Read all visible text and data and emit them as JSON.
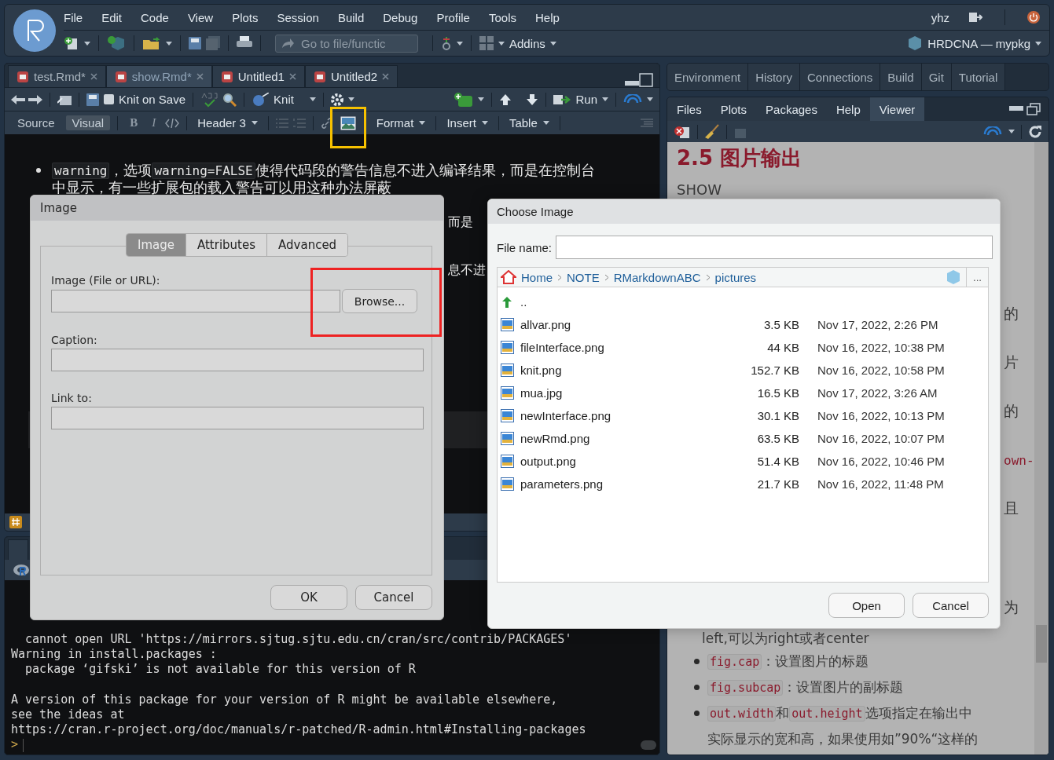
{
  "menu": [
    "File",
    "Edit",
    "Code",
    "View",
    "Plots",
    "Session",
    "Build",
    "Debug",
    "Profile",
    "Tools",
    "Help"
  ],
  "user": "yhz",
  "main_toolbar": {
    "goto_placeholder": "Go to file/functic",
    "addins": "Addins",
    "project": "HRDCNA — mypkg"
  },
  "source": {
    "tabs": [
      {
        "label": "test.Rmd*",
        "selected": false
      },
      {
        "label": "show.Rmd*",
        "selected": true
      },
      {
        "label": "Untitled1",
        "selected": false
      },
      {
        "label": "Untitled2",
        "selected": false
      }
    ],
    "knit_on_save": {
      "label": "Knit on Save",
      "checked": false
    },
    "knit": "Knit",
    "run": "Run",
    "modes": [
      {
        "label": "Source",
        "selected": false
      },
      {
        "label": "Visual",
        "selected": true
      }
    ],
    "format_items": [
      {
        "kind": "bold",
        "label": "B"
      },
      {
        "kind": "italic",
        "label": "I"
      },
      {
        "kind": "code"
      },
      {
        "kind": "menu",
        "label": "Header 3"
      },
      {
        "kind": "bullets"
      },
      {
        "kind": "numbers"
      },
      {
        "kind": "link"
      },
      {
        "kind": "image",
        "highlighted": true
      },
      {
        "kind": "menu",
        "label": "Format"
      },
      {
        "kind": "menu",
        "label": "Insert"
      },
      {
        "kind": "menu",
        "label": "Table"
      }
    ],
    "bullet": [
      {
        "kind": "code",
        "text": "warning"
      },
      {
        "kind": "text",
        "text": "，选项"
      },
      {
        "kind": "code",
        "text": "warning=FALSE"
      },
      {
        "kind": "text",
        "text": "使得代码段的警告信息不进入编译结果，而是在控制台"
      }
    ],
    "continuation": "中显示，有一些扩展包的载入警告可以用这种办法屏蔽",
    "fragments": [
      "而是",
      "息不进"
    ]
  },
  "console": {
    "lines": [
      "  cannot open URL 'https://mirrors.sjtug.sjtu.edu.cn/cran/src/contrib/PACKAGES'",
      "Warning in install.packages :",
      "  package ‘gifski’ is not available for this version of R",
      "A version of this package for your version of R might be available elsewhere,",
      "see the ideas at",
      "https://cran.r-project.org/doc/manuals/r-patched/R-admin.html#Installing-packages"
    ],
    "prompt": ">"
  },
  "env_tabs": [
    "Environment",
    "History",
    "Connections",
    "Build",
    "Git",
    "Tutorial"
  ],
  "files_tabs": [
    {
      "label": "Files",
      "selected": false
    },
    {
      "label": "Plots",
      "selected": false
    },
    {
      "label": "Packages",
      "selected": false
    },
    {
      "label": "Help",
      "selected": false
    },
    {
      "label": "Viewer",
      "selected": true
    }
  ],
  "viewer": {
    "heading": "2.5 图片输出",
    "subheading": "SHOW",
    "fragments": [
      {
        "kind": "text",
        "text": "的"
      },
      {
        "kind": "text",
        "text": "片"
      },
      {
        "kind": "text",
        "text": "的"
      },
      {
        "kind": "code",
        "text": "own-"
      },
      {
        "kind": "text",
        "text": "且"
      },
      {
        "kind": "text",
        "text": "为"
      }
    ],
    "line": "left,可以为right或者center",
    "bullets": [
      [
        {
          "kind": "code",
          "text": "fig.cap"
        },
        {
          "kind": "text",
          "text": "：设置图片的标题"
        }
      ],
      [
        {
          "kind": "code",
          "text": "fig.subcap"
        },
        {
          "kind": "text",
          "text": "：设置图片的副标题"
        }
      ],
      [
        {
          "kind": "code",
          "text": "out.width"
        },
        {
          "kind": "text",
          "text": "和"
        },
        {
          "kind": "code",
          "text": "out.height"
        },
        {
          "kind": "text",
          "text": "选项指定在输出中实际显示的宽和高，如果使用如”90%“这样的"
        }
      ]
    ]
  },
  "image_dialog": {
    "title": "Image",
    "tabs": [
      {
        "label": "Image",
        "selected": true
      },
      {
        "label": "Attributes",
        "selected": false
      },
      {
        "label": "Advanced",
        "selected": false
      }
    ],
    "fields": [
      {
        "kind": "file",
        "label": "Image (File or URL):",
        "browse": "Browse...",
        "highlighted": true
      },
      {
        "kind": "text",
        "label": "Caption:"
      },
      {
        "kind": "text",
        "label": "Link to:"
      }
    ],
    "buttons": [
      "OK",
      "Cancel"
    ]
  },
  "choose_dialog": {
    "title": "Choose Image",
    "file_name_label": "File name:",
    "path": [
      "Home",
      "NOTE",
      "RMarkdownABC",
      "pictures"
    ],
    "more": "...",
    "parent": "..",
    "files": [
      {
        "name": "allvar.png",
        "size": "3.5 KB",
        "modified": "Nov 17, 2022, 2:26 PM"
      },
      {
        "name": "fileInterface.png",
        "size": "44 KB",
        "modified": "Nov 16, 2022, 10:38 PM"
      },
      {
        "name": "knit.png",
        "size": "152.7 KB",
        "modified": "Nov 16, 2022, 10:58 PM"
      },
      {
        "name": "mua.jpg",
        "size": "16.5 KB",
        "modified": "Nov 17, 2022, 3:26 AM"
      },
      {
        "name": "newInterface.png",
        "size": "30.1 KB",
        "modified": "Nov 16, 2022, 10:13 PM"
      },
      {
        "name": "newRmd.png",
        "size": "63.5 KB",
        "modified": "Nov 16, 2022, 10:07 PM"
      },
      {
        "name": "output.png",
        "size": "51.4 KB",
        "modified": "Nov 16, 2022, 10:46 PM"
      },
      {
        "name": "parameters.png",
        "size": "21.7 KB",
        "modified": "Nov 16, 2022, 11:48 PM"
      }
    ],
    "buttons": [
      "Open",
      "Cancel"
    ]
  }
}
